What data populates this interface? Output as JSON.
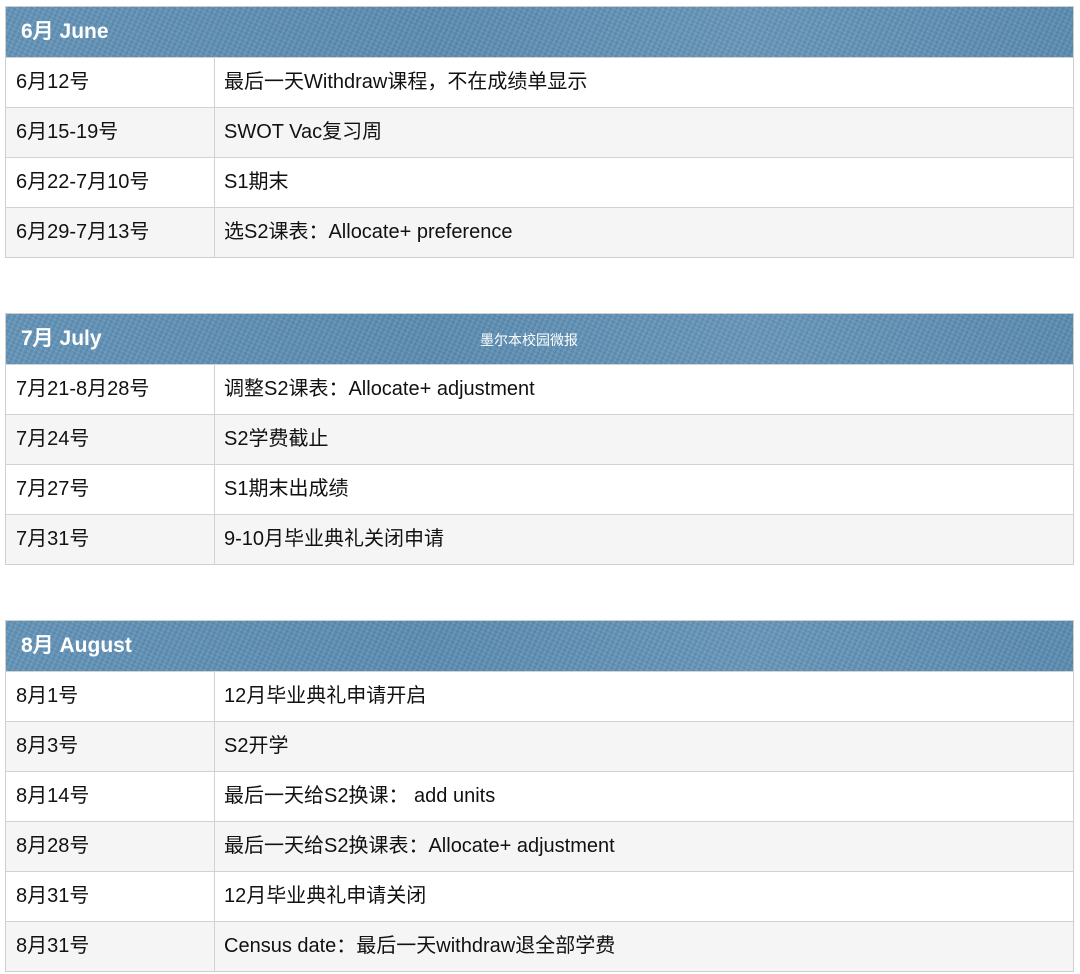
{
  "sections": [
    {
      "title": "6月 June",
      "rows": [
        {
          "date": "6月12号",
          "event": "最后一天Withdraw课程，不在成绩单显示"
        },
        {
          "date": "6月15-19号",
          "event": "SWOT Vac复习周"
        },
        {
          "date": "6月22-7月10号",
          "event": "S1期末"
        },
        {
          "date": "6月29-7月13号",
          "event": "选S2课表：Allocate+ preference"
        }
      ]
    },
    {
      "title": "7月 July",
      "watermark": "墨尔本校园微报",
      "rows": [
        {
          "date": "7月21-8月28号",
          "event": "调整S2课表：Allocate+ adjustment"
        },
        {
          "date": "7月24号",
          "event": "S2学费截止"
        },
        {
          "date": "7月27号",
          "event": "S1期末出成绩"
        },
        {
          "date": "7月31号",
          "event": "9-10月毕业典礼关闭申请"
        }
      ]
    },
    {
      "title": "8月 August",
      "rows": [
        {
          "date": "8月1号",
          "event": "12月毕业典礼申请开启"
        },
        {
          "date": "8月3号",
          "event": "S2开学"
        },
        {
          "date": "8月14号",
          "event": "最后一天给S2换课： add units"
        },
        {
          "date": "8月28号",
          "event": "最后一天给S2换课表：Allocate+ adjustment"
        },
        {
          "date": "8月31号",
          "event": "12月毕业典礼申请关闭"
        },
        {
          "date": "8月31号",
          "event": "Census date：最后一天withdraw退全部学费"
        }
      ]
    }
  ],
  "colors": {
    "header_bg": "#5f8fb4",
    "header_text": "#ffffff",
    "row_alt_bg": "#f5f5f5",
    "border": "#d2d2d2"
  }
}
